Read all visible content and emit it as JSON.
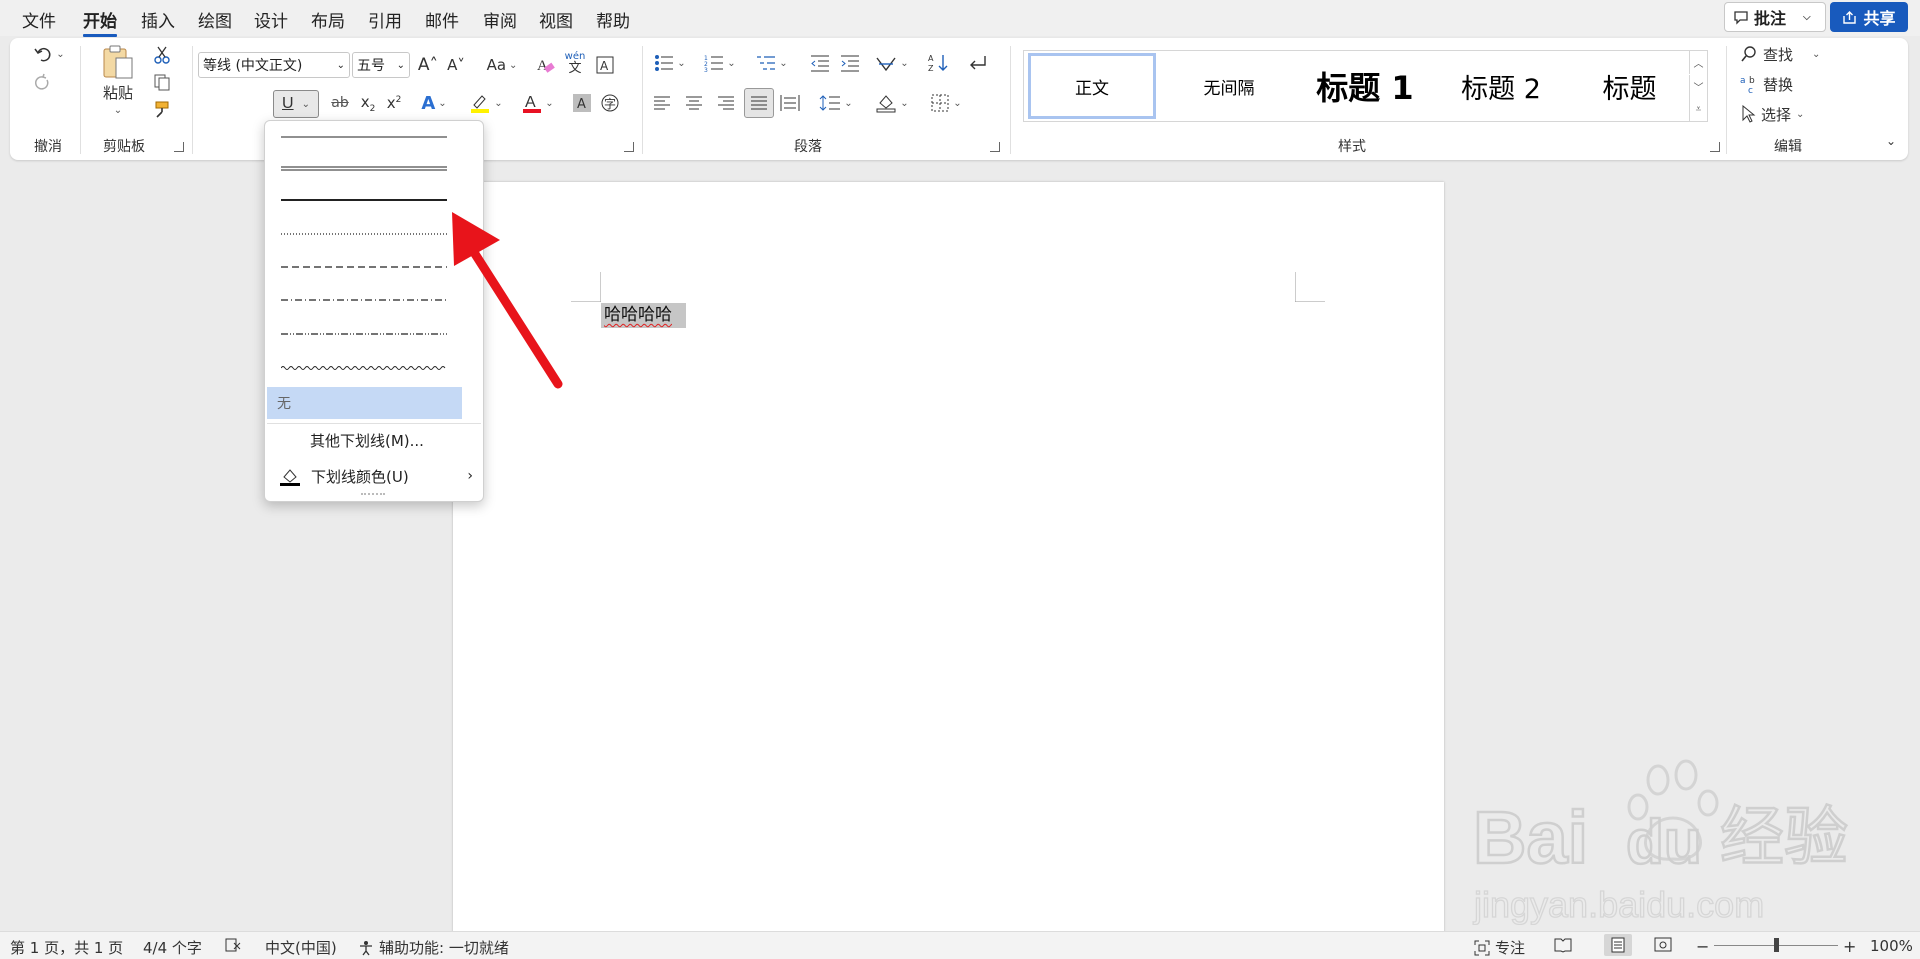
{
  "menu": {
    "tabs": [
      "文件",
      "开始",
      "插入",
      "绘图",
      "设计",
      "布局",
      "引用",
      "邮件",
      "审阅",
      "视图",
      "帮助"
    ],
    "active": "开始",
    "comments_label": "批注",
    "share_label": "共享"
  },
  "ribbon": {
    "groups": {
      "undo": "撤消",
      "clipboard": "剪贴板",
      "paragraph": "段落",
      "styles": "样式",
      "editing": "编辑"
    },
    "paste_label": "粘贴",
    "font_name": "等线 (中文正文)",
    "font_size": "五号",
    "phonetic_top": "wén",
    "phonetic_bottom": "文",
    "style_gallery": [
      "正文",
      "无间隔",
      "标题 1",
      "标题 2",
      "标题"
    ],
    "find_label": "查找",
    "replace_label": "替换",
    "select_label": "选择"
  },
  "underline_menu": {
    "none_label": "无",
    "more_label": "其他下划线(M)...",
    "color_label": "下划线颜色(U)"
  },
  "document": {
    "selected_text": "哈哈哈哈"
  },
  "status": {
    "page": "第 1 页，共 1 页",
    "words": "4/4 个字",
    "language": "中文(中国)",
    "accessibility": "辅助功能: 一切就绪",
    "focus": "专注",
    "zoom": "100%",
    "zoom_level": 1.0
  },
  "watermark": {
    "brand": "Baidu经验",
    "url": "jingyan.baidu.com"
  },
  "colors": {
    "accent": "#185abd",
    "highlight_menu": "#c5d9f5",
    "arrow": "#e8141b",
    "text_selection": "#c6c6c6"
  }
}
